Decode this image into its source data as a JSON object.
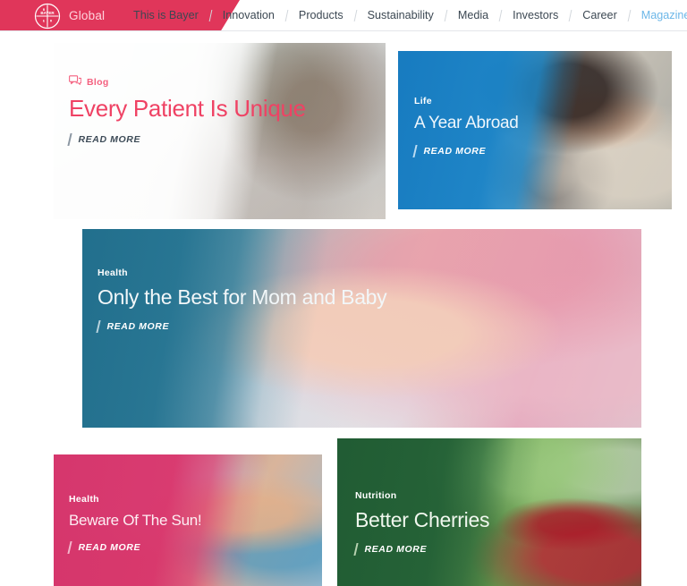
{
  "header": {
    "brand_label": "Global",
    "logo_name": "bayer-cross-logo",
    "search_icon": "search-icon",
    "nav": [
      {
        "label": "This is Bayer",
        "active": false
      },
      {
        "label": "Innovation",
        "active": false
      },
      {
        "label": "Products",
        "active": false
      },
      {
        "label": "Sustainability",
        "active": false
      },
      {
        "label": "Media",
        "active": false
      },
      {
        "label": "Investors",
        "active": false
      },
      {
        "label": "Career",
        "active": false
      },
      {
        "label": "Magazine",
        "active": true
      }
    ]
  },
  "colors": {
    "brand_red": "#e0365a",
    "accent_pink": "#ef4264",
    "active_nav_blue": "#6cb7e8",
    "card_life_blue": "#137ac1",
    "card_baby_teal": "#206e8c",
    "card_sun_magenta": "#d63068",
    "card_cherries_green": "#1f5b33",
    "readmore_dark": "#3d4b57"
  },
  "cards": [
    {
      "id": "card-blog",
      "category": "Blog",
      "category_icon": "chat-bubble-icon",
      "title": "Every Patient Is Unique",
      "read_more": "READ MORE"
    },
    {
      "id": "card-life",
      "category": "Life",
      "title": "A Year Abroad",
      "read_more": "READ MORE"
    },
    {
      "id": "card-baby",
      "category": "Health",
      "title": "Only the Best for Mom and Baby",
      "read_more": "READ MORE"
    },
    {
      "id": "card-sun",
      "category": "Health",
      "title": "Beware Of The Sun!",
      "read_more": "READ MORE"
    },
    {
      "id": "card-cherries",
      "category": "Nutrition",
      "title": "Better Cherries",
      "read_more": "READ MORE"
    }
  ]
}
